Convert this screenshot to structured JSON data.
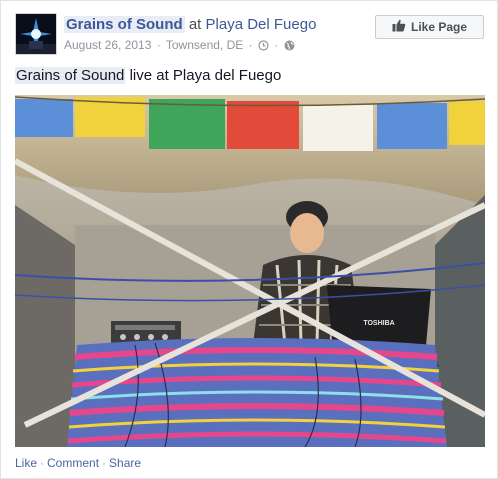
{
  "post": {
    "page_name": "Grains of Sound",
    "at_word": "at",
    "location": "Playa Del Fuego",
    "date": "August 26, 2013",
    "place": "Townsend, DE",
    "caption_tag": "Grains of Sound",
    "caption_rest": " live at Playa del Fuego"
  },
  "like_page_button": {
    "label": "Like Page",
    "icon": "thumbs-up-icon"
  },
  "photo": {
    "laptop_brand": "TOSHIBA"
  },
  "actions": {
    "like": "Like",
    "comment": "Comment",
    "share": "Share",
    "separator": "·"
  },
  "colors": {
    "link": "#3b5998",
    "meta": "#90949c",
    "button_bg": "#f6f7f9"
  }
}
